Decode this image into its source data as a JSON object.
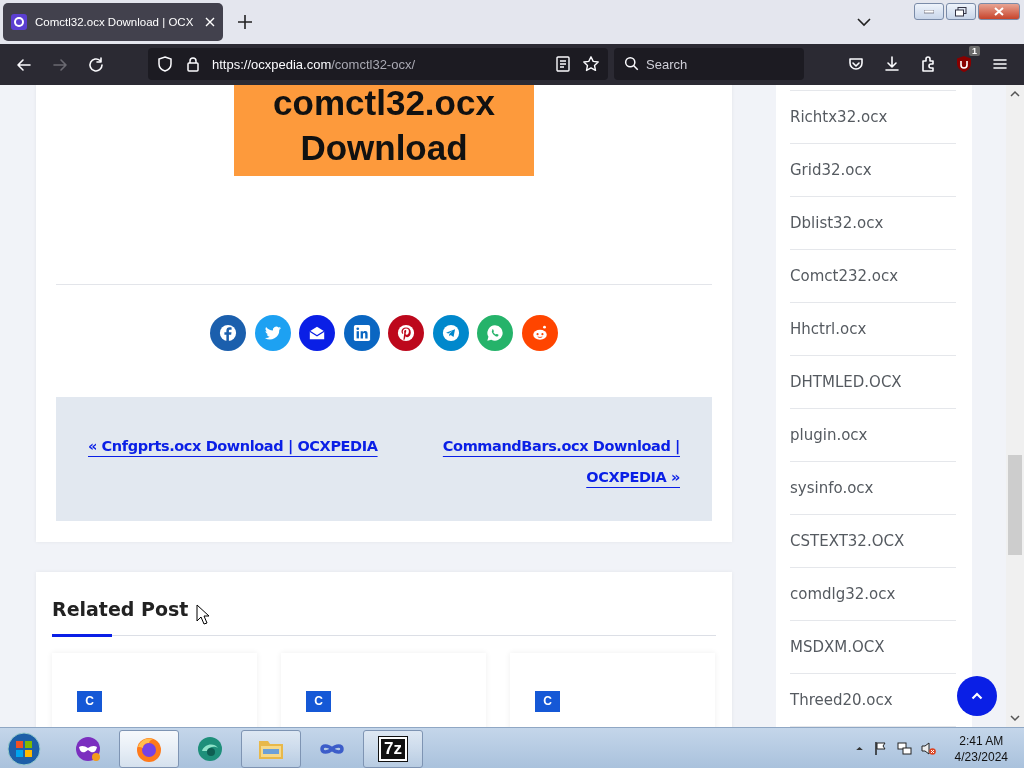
{
  "browser": {
    "tab_title": "Comctl32.ocx Download | OCX",
    "url_host": "https://ocxpedia.com",
    "url_path": "/comctl32-ocx/",
    "search_placeholder": "Search",
    "addon_badge": "1",
    "forward_disabled": true
  },
  "article": {
    "banner_lines": [
      "comctl32.ocx",
      "Download"
    ],
    "share_buttons": [
      {
        "kind": "facebook",
        "color": "#1b5fad"
      },
      {
        "kind": "twitter",
        "color": "#1da1f2"
      },
      {
        "kind": "email",
        "color": "#0a1fe6"
      },
      {
        "kind": "linkedin",
        "color": "#0a66c2"
      },
      {
        "kind": "pinterest",
        "color": "#bd081c"
      },
      {
        "kind": "telegram",
        "color": "#0088cc"
      },
      {
        "kind": "whatsapp",
        "color": "#25b36a"
      },
      {
        "kind": "reddit",
        "color": "#ff4500"
      }
    ],
    "previous_post": "« Cnfgprts.ocx Download | OCXPEDIA",
    "next_post": "CommandBars.ocx Download | OCXPEDIA »"
  },
  "related": {
    "heading": "Related Post",
    "cards": [
      {
        "category": "C"
      },
      {
        "category": "C"
      },
      {
        "category": "C"
      }
    ]
  },
  "sidebar": {
    "items": [
      "Richtx32.ocx",
      "Grid32.ocx",
      "Dblist32.ocx",
      "Comct232.ocx",
      "Hhctrl.ocx",
      "DHTMLED.OCX",
      "plugin.ocx",
      "sysinfo.ocx",
      "CSTEXT32.OCX",
      "comdlg32.ocx",
      "MSDXM.OCX",
      "Threed20.ocx"
    ]
  },
  "taskbar": {
    "apps": [
      {
        "kind": "mask",
        "running": false,
        "selected": false
      },
      {
        "kind": "firefox",
        "running": true,
        "selected": true
      },
      {
        "kind": "orb",
        "running": false,
        "selected": false
      },
      {
        "kind": "folder",
        "running": true,
        "selected": false
      },
      {
        "kind": "infinity",
        "running": false,
        "selected": false
      },
      {
        "kind": "archive",
        "label": "7z",
        "running": true,
        "selected": false
      }
    ],
    "time": "2:41 AM",
    "date": "4/23/2024"
  }
}
